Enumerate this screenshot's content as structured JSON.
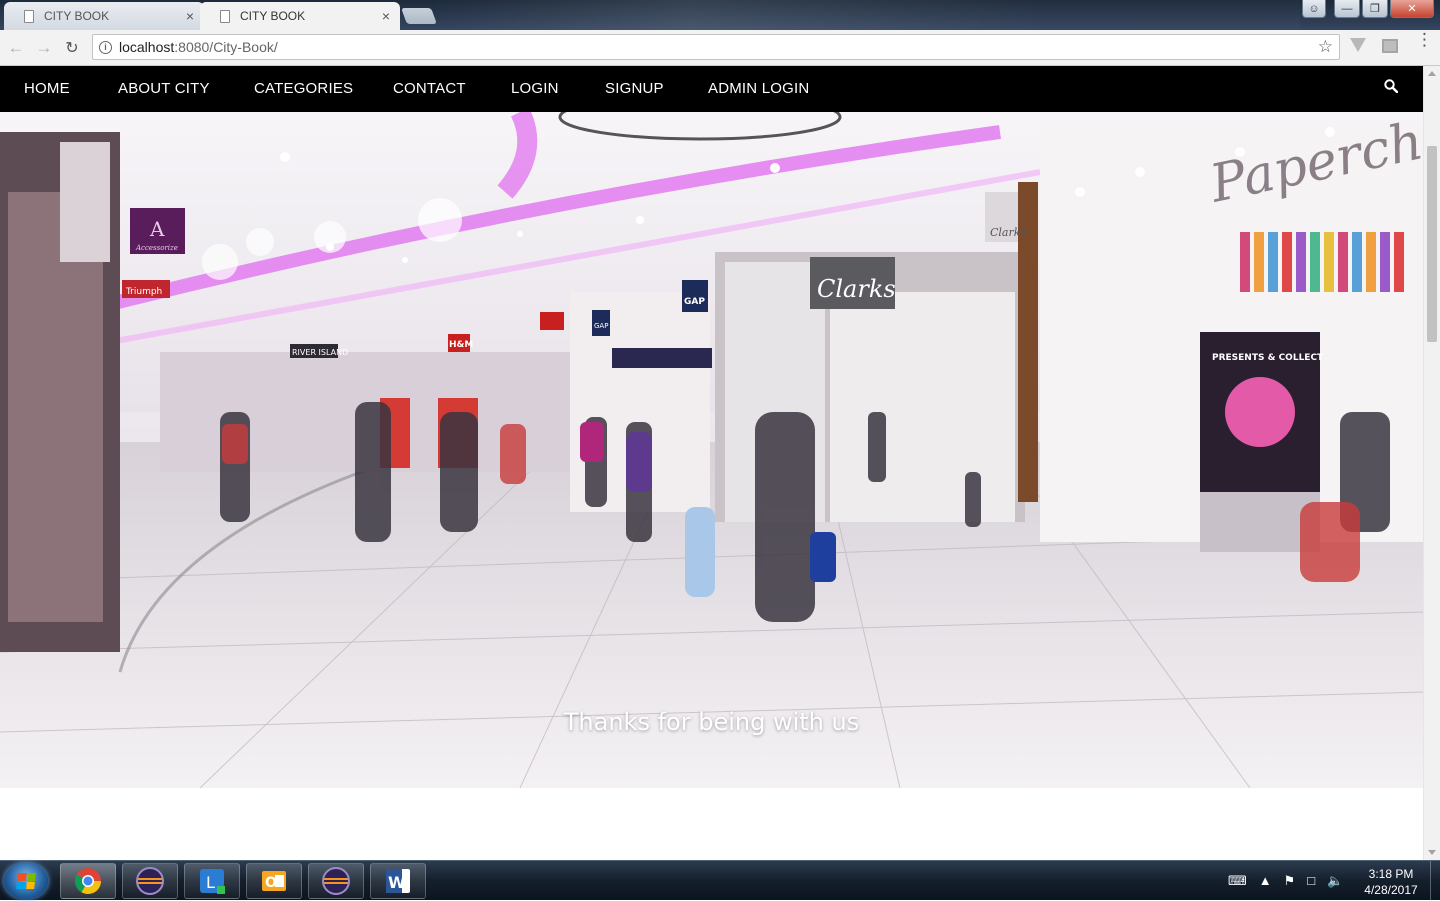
{
  "browser": {
    "tabs": [
      {
        "title": "CITY BOOK",
        "active": false
      },
      {
        "title": "CITY BOOK",
        "active": true
      }
    ],
    "url_host": "localhost",
    "url_path": ":8080/City-Book/",
    "close_glyph": "×"
  },
  "site": {
    "nav": [
      "HOME",
      "ABOUT CITY",
      "CATEGORIES",
      "CONTACT",
      "LOGIN",
      "SIGNUP",
      "ADMIN LOGIN"
    ],
    "hero_caption": "Thanks for being with us",
    "store_signs": {
      "clarks": "Clarks",
      "clarks_small": "Clarks",
      "gap": "GAP",
      "gap_small": "GAP",
      "hm": "H&M",
      "river_island": "RIVER ISLAND",
      "paperchase": "Paperchase",
      "poster_line": "PRESENTS & COLLECT",
      "triumph": "Triumph",
      "accessorize_letter": "A",
      "accessorize": "Accessorize"
    }
  },
  "taskbar": {
    "apps": [
      "chrome",
      "eclipse",
      "lync",
      "outlook",
      "eclipse",
      "word"
    ],
    "time": "3:18 PM",
    "date": "4/28/2017"
  },
  "colors": {
    "nav_bg": "#000000",
    "nav_text": "#ffffff",
    "neon": "#e27bf0"
  }
}
